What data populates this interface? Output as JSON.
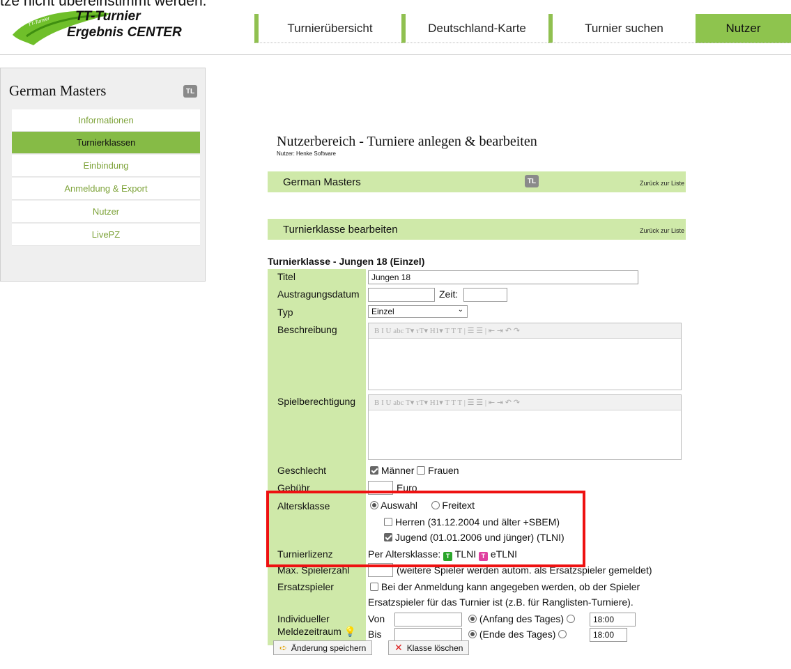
{
  "top_cut_text": "tze nicht übereinstimmt werden.",
  "logo": {
    "small_text": "TT-Turnier",
    "line1": "TT-Turnier",
    "line2": "Ergebnis CENTER"
  },
  "nav": [
    "Turnierübersicht",
    "Deutschland-Karte",
    "Turnier suchen",
    "Nutzer"
  ],
  "sidebar": {
    "title": "German Masters",
    "badge": "TL",
    "items": [
      "Informationen",
      "Turnierklassen",
      "Einbindung",
      "Anmeldung & Export",
      "Nutzer",
      "LivePZ"
    ]
  },
  "main": {
    "title": "Nutzerbereich - Turniere anlegen & bearbeiten",
    "user_line": "Nutzer: Henke Software",
    "bar1": {
      "title": "German Masters",
      "badge": "TL",
      "back": "Zurück zur Liste"
    },
    "bar2": {
      "title": "Turnierklasse bearbeiten",
      "back": "Zurück zur Liste"
    },
    "form_title": "Turnierklasse - Jungen 18 (Einzel)"
  },
  "form": {
    "labels": {
      "titel": "Titel",
      "datum": "Austragungsdatum",
      "typ": "Typ",
      "beschreibung": "Beschreibung",
      "spielberechtigung": "Spielberechtigung",
      "geschlecht": "Geschlecht",
      "gebuehr": "Gebühr",
      "altersklasse": "Altersklasse",
      "turnierlizenz": "Turnierlizenz",
      "max": "Max. Spielerzahl",
      "ersatz": "Ersatzspieler",
      "indiv1": "Individueller",
      "indiv2": "Meldezeitraum"
    },
    "titel_value": "Jungen 18",
    "zeit_label": "Zeit:",
    "typ_value": "Einzel",
    "toolbar": "B  I  U  abc  T▾  тT▾  H1▾  T  T  T  |  ☰  ☰  |  ⇤  ⇥  ↶  ↷",
    "geschlecht": {
      "maenner": "Männer",
      "frauen": "Frauen"
    },
    "gebuehr_unit": "Euro",
    "altersklasse": {
      "auswahl": "Auswahl",
      "freitext": "Freitext",
      "herren": "Herren (31.12.2004 und älter +SBEM)",
      "jugend": "Jugend (01.01.2006 und jünger) (TLNI)"
    },
    "turnierlizenz": {
      "prefix": "Per Altersklasse:",
      "tlni": "TLNI",
      "etlni": "eTLNI",
      "tlni_icon_color": "#2aa52a",
      "etlni_icon_color": "#e040a0"
    },
    "max_note": "(weitere Spieler werden autom. als Ersatzspieler gemeldet)",
    "ersatz_line1": "Bei der Anmeldung kann angegeben werden, ob der Spieler",
    "ersatz_line2": "Ersatzspieler für das Turnier ist (z.B. für Ranglisten-Turniere).",
    "von": "Von",
    "bis": "Bis",
    "anfang": "(Anfang des Tages)",
    "ende": "(Ende des Tages)",
    "time1": "18:00",
    "time2": "18:00"
  },
  "buttons": {
    "save": "Änderung speichern",
    "delete": "Klasse löschen"
  },
  "colors": {
    "accent": "#8ec44e",
    "bar": "#cfe9a9",
    "highlight": "#e11111"
  }
}
